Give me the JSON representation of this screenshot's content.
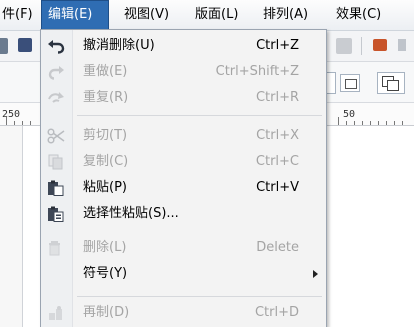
{
  "menubar": {
    "items": [
      {
        "label": "件(F)"
      },
      {
        "label": "编辑(E)"
      },
      {
        "label": "视图(V)"
      },
      {
        "label": "版面(L)"
      },
      {
        "label": "排列(A)"
      },
      {
        "label": "效果(C)"
      }
    ]
  },
  "ruler": {
    "marks": [
      "250",
      "50"
    ]
  },
  "edit_menu": {
    "items": [
      {
        "label": "撤消删除(U)",
        "shortcut": "Ctrl+Z",
        "icon": "undo-icon",
        "enabled": true
      },
      {
        "label": "重做(E)",
        "shortcut": "Ctrl+Shift+Z",
        "icon": "redo-icon",
        "enabled": false
      },
      {
        "label": "重复(R)",
        "shortcut": "Ctrl+R",
        "icon": "repeat-icon",
        "enabled": false
      },
      {
        "label": "剪切(T)",
        "shortcut": "Ctrl+X",
        "icon": "scissors-icon",
        "enabled": false
      },
      {
        "label": "复制(C)",
        "shortcut": "Ctrl+C",
        "icon": "copy-icon",
        "enabled": false
      },
      {
        "label": "粘贴(P)",
        "shortcut": "Ctrl+V",
        "icon": "paste-icon",
        "enabled": true
      },
      {
        "label": "选择性粘贴(S)...",
        "shortcut": "",
        "icon": "paste-special-icon",
        "enabled": true
      },
      {
        "label": "删除(L)",
        "shortcut": "Delete",
        "icon": "trash-icon",
        "enabled": false
      },
      {
        "label": "符号(Y)",
        "shortcut": "",
        "icon": "",
        "enabled": true,
        "submenu": true
      },
      {
        "label": "再制(D)",
        "shortcut": "Ctrl+D",
        "icon": "duplicate-icon",
        "enabled": false
      }
    ]
  },
  "colors": {
    "menu_highlight": "#2f6db3",
    "disabled_text": "#a4a4a4"
  }
}
